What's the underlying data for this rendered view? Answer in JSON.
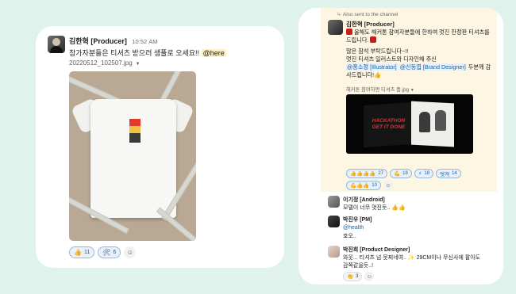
{
  "left_message": {
    "author": "김한혁 [Producer]",
    "time": "10:52 AM",
    "text": "참가자분들은 티셔츠 받으러 샘플로 오세요!!",
    "mention": "@here",
    "file_name": "20220512_102507.jpg",
    "reactions": [
      {
        "emoji": "👍",
        "count": "11"
      },
      {
        "emoji": "🛠",
        "count": "6"
      }
    ]
  },
  "right_thread": {
    "also_sent": "Also sent to the channel",
    "main": {
      "author": "김한혁 [Producer]",
      "line1": "올해도 해커톤 참여자분들에 한하여 멋진 한정판 티셔츠를 드립니다.",
      "line2": "많은 참석 부탁드립니다~!!",
      "line3": "멋진 티셔츠 일러스트와 디자인해 주신",
      "mention1": "@홍소정 [Illustrator]",
      "mention2": "@신동엽 [Brand Designer]",
      "line4_suffix": " 두분께 감사드립니다!",
      "file_name": "해커톤 참여하면 티셔츠 줌.jpg",
      "book_text": "HACKATHON GET IT DONE",
      "reactions_row1": [
        {
          "emoji": "👍👍👍👍",
          "count": "27"
        },
        {
          "emoji": "💪",
          "count": "18"
        },
        {
          "emoji": "⚡",
          "count": "18"
        },
        {
          "emoji": "멋져",
          "count": "14"
        }
      ],
      "reactions_row2": [
        {
          "emoji": "💪👍👍",
          "count": "10"
        }
      ]
    },
    "replies": [
      {
        "author": "이기정 [Android]",
        "text": "모델이 너무 멋진듯.. 👍👍"
      },
      {
        "author": "박진우 [PM]",
        "mention": "@health",
        "text": "호오.."
      },
      {
        "author": "박진희 [Product Designer]",
        "text": "와웃... 티셔츠 넘 뭇찌네여.. ✨ 29CM이나 무신사에 팔아도 감쪽같을듯..!",
        "reaction_emoji": "👏",
        "reaction_count": "3"
      }
    ]
  }
}
